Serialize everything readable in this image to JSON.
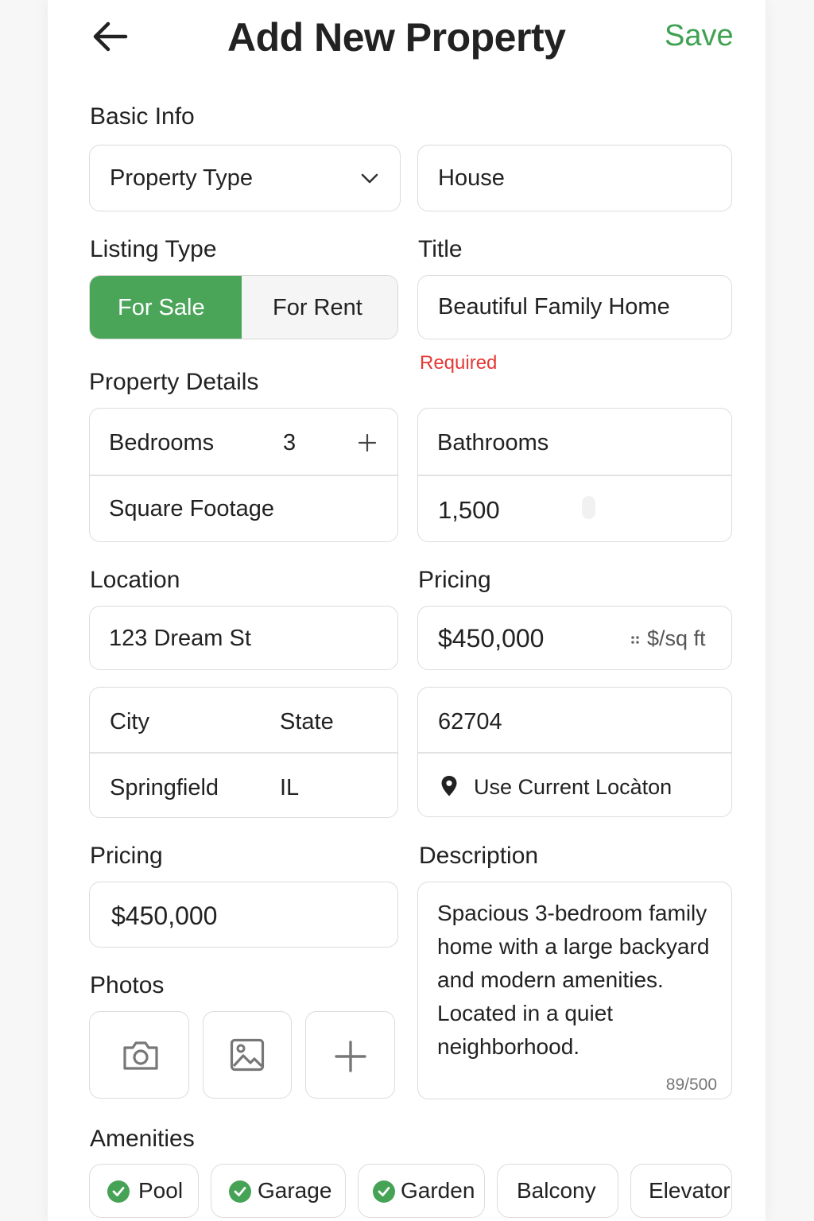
{
  "header": {
    "title": "Add New Property",
    "save_label": "Save"
  },
  "basic_info": {
    "heading": "Basic Info",
    "property_type_label": "Property Type",
    "property_type_value": "House"
  },
  "listing_type": {
    "heading": "Listing Type",
    "options": [
      "For Sale",
      "For Rent"
    ],
    "selected": "For Sale"
  },
  "title_field": {
    "heading": "Title",
    "value": "Beautiful Family Home",
    "error": "Required"
  },
  "property_details": {
    "heading": "Property Details",
    "bedrooms_label": "Bedrooms",
    "bedrooms_value": "3",
    "square_footage_label": "Square Footage",
    "bathrooms_label": "Bathrooms",
    "square_footage_value": "1,500"
  },
  "location": {
    "heading": "Location",
    "street": "123 Dream St",
    "city_label": "City",
    "state_label": "State",
    "city_value": "Springfield",
    "state_value": "IL",
    "zip": "62704",
    "use_current_location": "Use Current Locàton"
  },
  "pricing_top": {
    "heading": "Pricing",
    "price": "$450,000",
    "unit": "$/sq ft"
  },
  "pricing_bottom": {
    "heading": "Pricing",
    "price": "$450,000"
  },
  "description": {
    "heading": "Description",
    "text": "Spacious 3-bedroom family home with a large backyard and modern amenities. Located in a quiet neighborhood.",
    "counter": "89/500"
  },
  "photos": {
    "heading": "Photos",
    "buttons": [
      "camera-icon",
      "image-icon",
      "plus-icon"
    ]
  },
  "amenities": {
    "heading": "Amenities",
    "items": [
      {
        "label": "Pool",
        "checked": true
      },
      {
        "label": "Garage",
        "checked": true
      },
      {
        "label": "Garden",
        "checked": true
      },
      {
        "label": "Balcony",
        "checked": false
      },
      {
        "label": "Elevator",
        "checked": false
      }
    ]
  },
  "colors": {
    "accent": "#4aa559",
    "save": "#3fa252",
    "error": "#e53935",
    "border": "#dcdcdc"
  }
}
